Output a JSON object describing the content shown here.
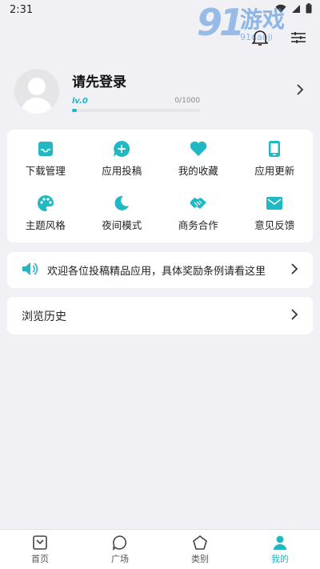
{
  "status_bar": {
    "time": "2:31"
  },
  "watermark": {
    "brand_num": "9",
    "brand_text": "游戏",
    "domain": "91danji"
  },
  "colors": {
    "accent": "#1fb8c3",
    "background": "#f1f0f5"
  },
  "header": {
    "actions": [
      {
        "name": "bell-icon"
      },
      {
        "name": "settings-sliders-icon"
      }
    ]
  },
  "profile": {
    "login_text": "请先登录",
    "level": "lv.0",
    "exp": "0/1000",
    "progress": 0.04
  },
  "grid": [
    {
      "label": "下载管理",
      "icon": "inbox-icon"
    },
    {
      "label": "应用投稿",
      "icon": "chat-plus-icon"
    },
    {
      "label": "我的收藏",
      "icon": "heart-icon"
    },
    {
      "label": "应用更新",
      "icon": "phone-icon"
    },
    {
      "label": "主题风格",
      "icon": "palette-icon"
    },
    {
      "label": "夜间模式",
      "icon": "moon-icon"
    },
    {
      "label": "商务合作",
      "icon": "handshake-icon"
    },
    {
      "label": "意见反馈",
      "icon": "mail-icon"
    }
  ],
  "notice": {
    "text": "欢迎各位投稿精品应用，具体奖励条例请看这里",
    "icon": "speaker-icon"
  },
  "history": {
    "label": "浏览历史"
  },
  "bottom_nav": [
    {
      "label": "首页",
      "icon": "home-icon",
      "active": false
    },
    {
      "label": "广场",
      "icon": "chat-bubble-icon",
      "active": false
    },
    {
      "label": "类别",
      "icon": "pentagon-icon",
      "active": false
    },
    {
      "label": "我的",
      "icon": "user-icon",
      "active": true
    }
  ]
}
